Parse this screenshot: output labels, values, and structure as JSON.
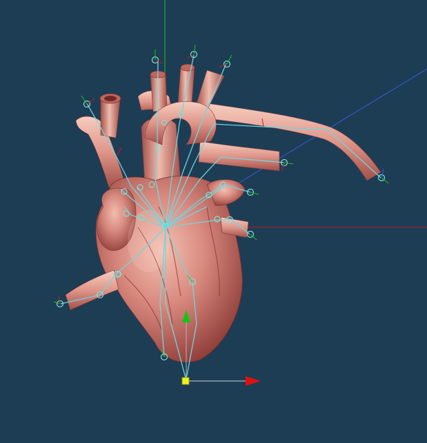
{
  "viewport": {
    "background": "#1d3d55",
    "axis_colors": {
      "x": "#d01818",
      "y": "#19c419",
      "z": "#4060e0"
    },
    "model_colors": {
      "tissue": "#d98a7f",
      "tissue_dark": "#9e4a44",
      "tissue_light": "#f2c2b4"
    },
    "rig_color": "#6fd6e0"
  },
  "scene": {
    "model": "heart-model",
    "icons": [
      "transform-gizmo-icon",
      "joint-icon",
      "bone-icon",
      "move-arrow-icon"
    ]
  }
}
